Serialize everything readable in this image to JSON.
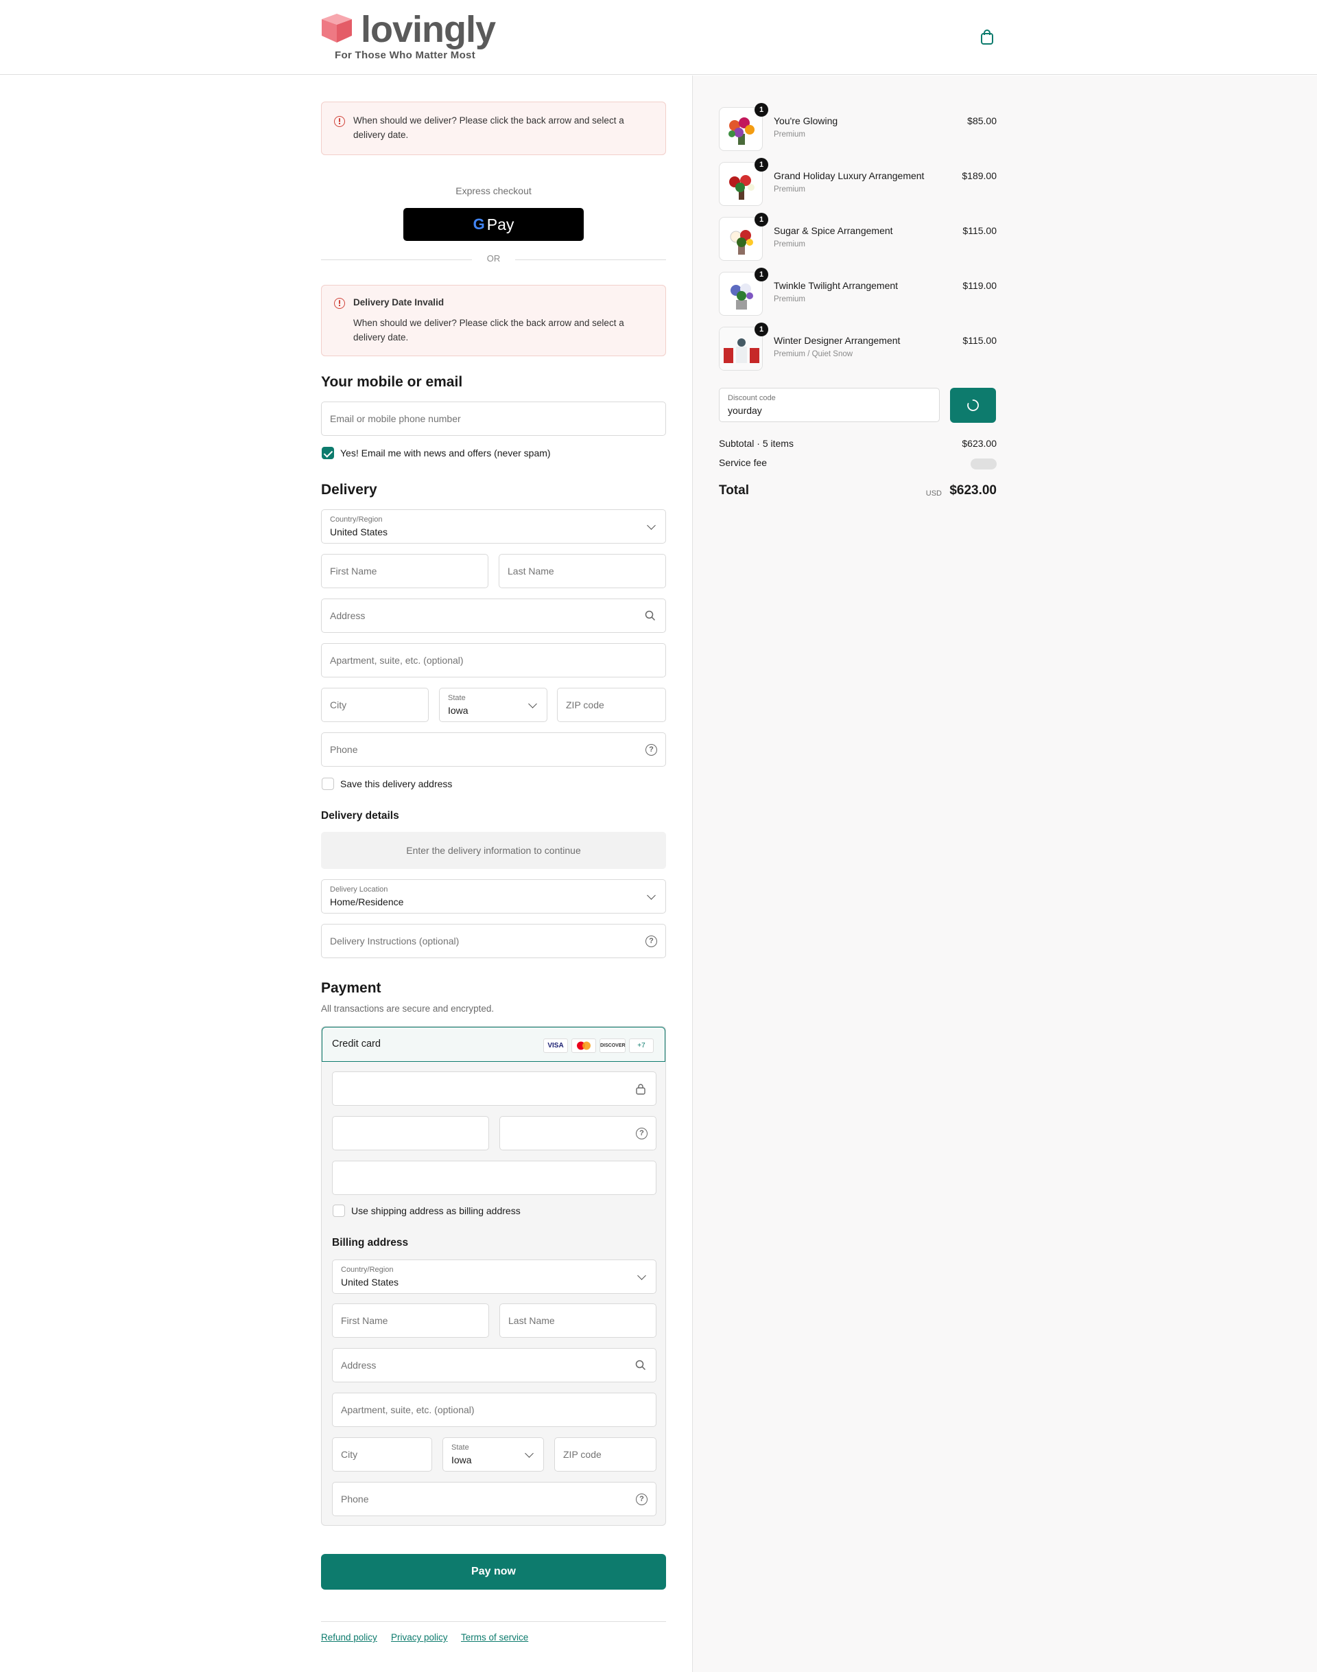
{
  "brand": {
    "name": "lovingly",
    "tagline": "For Those Who Matter Most"
  },
  "alerts": {
    "top": "When should we deliver? Please click the back arrow and select a delivery date.",
    "invalid_title": "Delivery Date Invalid",
    "invalid_body": "When should we deliver? Please click the back arrow and select a delivery date."
  },
  "express": {
    "label": "Express checkout",
    "gpay": "Pay",
    "or": "OR"
  },
  "contact": {
    "heading": "Your mobile or email",
    "placeholder": "Email or mobile phone number",
    "newsletter": "Yes! Email me with news and offers (never spam)",
    "newsletter_checked": true
  },
  "delivery": {
    "heading": "Delivery",
    "country_label": "Country/Region",
    "country": "United States",
    "first": "First Name",
    "last": "Last Name",
    "address": "Address",
    "apt": "Apartment, suite, etc. (optional)",
    "city": "City",
    "state_label": "State",
    "state": "Iowa",
    "zip": "ZIP code",
    "phone": "Phone",
    "save": "Save this delivery address"
  },
  "details": {
    "heading": "Delivery details",
    "info": "Enter the delivery information to continue",
    "location_label": "Delivery Location",
    "location": "Home/Residence",
    "instructions": "Delivery Instructions (optional)"
  },
  "payment": {
    "heading": "Payment",
    "sub": "All transactions are secure and encrypted.",
    "method": "Credit card",
    "cards": [
      "VISA",
      "MC",
      "DISCOVER",
      "+7"
    ],
    "use_shipping": "Use shipping address as billing address",
    "billing_heading": "Billing address",
    "pay": "Pay now"
  },
  "footer": {
    "links": [
      "Refund policy",
      "Privacy policy",
      "Terms of service"
    ]
  },
  "cart": {
    "items": [
      {
        "name": "You're Glowing",
        "variant": "Premium",
        "price": "$85.00",
        "qty": "1"
      },
      {
        "name": "Grand Holiday Luxury Arrangement",
        "variant": "Premium",
        "price": "$189.00",
        "qty": "1"
      },
      {
        "name": "Sugar & Spice Arrangement",
        "variant": "Premium",
        "price": "$115.00",
        "qty": "1"
      },
      {
        "name": "Twinkle Twilight Arrangement",
        "variant": "Premium",
        "price": "$119.00",
        "qty": "1"
      },
      {
        "name": "Winter Designer Arrangement",
        "variant": "Premium / Quiet Snow",
        "price": "$115.00",
        "qty": "1"
      }
    ],
    "discount_label": "Discount code",
    "discount_value": "yourday",
    "subtotal_label": "Subtotal · 5 items",
    "subtotal": "$623.00",
    "fee_label": "Service fee",
    "total_label": "Total",
    "currency": "USD",
    "total": "$623.00"
  },
  "colors": {
    "accent": "#0d7b6d",
    "error": "#d0433a"
  }
}
